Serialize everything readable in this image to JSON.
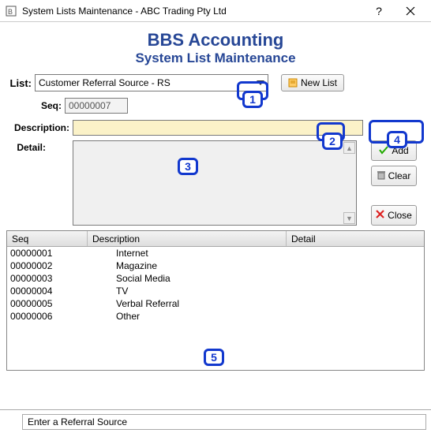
{
  "window": {
    "title": "System Lists Maintenance - ABC Trading Pty Ltd"
  },
  "headings": {
    "app": "BBS Accounting",
    "page": "System List Maintenance"
  },
  "labels": {
    "list": "List:",
    "seq": "Seq:",
    "description": "Description:",
    "detail": "Detail:"
  },
  "list_select": {
    "value": "Customer Referral Source - RS"
  },
  "buttons": {
    "new_list": "New List",
    "add": "Add",
    "clear": "Clear",
    "close": "Close"
  },
  "fields": {
    "seq": "00000007",
    "description": "",
    "detail": ""
  },
  "callouts": {
    "c1": "1",
    "c2": "2",
    "c3": "3",
    "c4": "4",
    "c5": "5"
  },
  "table": {
    "headers": {
      "seq": "Seq",
      "description": "Description",
      "detail": "Detail"
    },
    "rows": [
      {
        "seq": "00000001",
        "description": "Internet",
        "detail": ""
      },
      {
        "seq": "00000002",
        "description": "Magazine",
        "detail": ""
      },
      {
        "seq": "00000003",
        "description": "Social Media",
        "detail": ""
      },
      {
        "seq": "00000004",
        "description": "TV",
        "detail": ""
      },
      {
        "seq": "00000005",
        "description": "Verbal Referral",
        "detail": ""
      },
      {
        "seq": "00000006",
        "description": "Other",
        "detail": ""
      }
    ]
  },
  "status": "Enter a Referral Source"
}
